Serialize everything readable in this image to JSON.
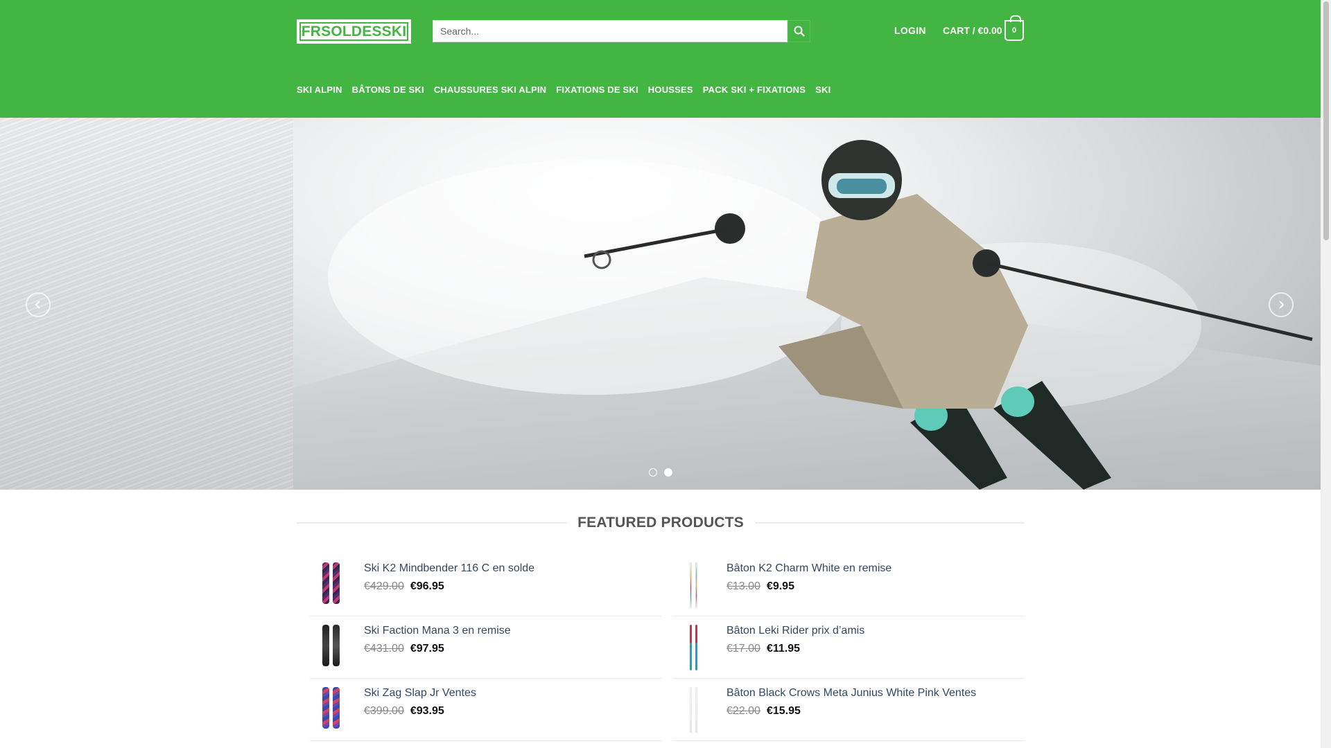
{
  "header": {
    "logo": "FRSOLDESSKI",
    "search_placeholder": "Search...",
    "login": "LOGIN",
    "cart_label": "CART / €0.00",
    "cart_count": "0",
    "brand_color": "#43b542"
  },
  "nav": {
    "items": [
      {
        "label": "SKI ALPIN"
      },
      {
        "label": "BÂTONS DE SKI"
      },
      {
        "label": "CHAUSSURES SKI ALPIN"
      },
      {
        "label": "FIXATIONS DE SKI"
      },
      {
        "label": "HOUSSES"
      },
      {
        "label": "PACK SKI + FIXATIONS"
      },
      {
        "label": "SKI"
      }
    ]
  },
  "hero": {
    "slides": 2,
    "active_slide": 2
  },
  "featured": {
    "title": "FEATURED PRODUCTS",
    "products": [
      {
        "name": "Ski K2 Mindbender 116 C en solde",
        "old_price": "€429.00",
        "price": "€96.95"
      },
      {
        "name": "Bâton K2 Charm White en remise",
        "old_price": "€13.00",
        "price": "€9.95"
      },
      {
        "name": "Ski Faction Mana 3 en remise",
        "old_price": "€431.00",
        "price": "€97.95"
      },
      {
        "name": "Bâton Leki Rider prix d’amis",
        "old_price": "€17.00",
        "price": "€11.95"
      },
      {
        "name": "Ski Zag Slap Jr Ventes",
        "old_price": "€399.00",
        "price": "€93.95"
      },
      {
        "name": "Bâton Black Crows Meta Junius White Pink Ventes",
        "old_price": "€22.00",
        "price": "€15.95"
      }
    ]
  }
}
